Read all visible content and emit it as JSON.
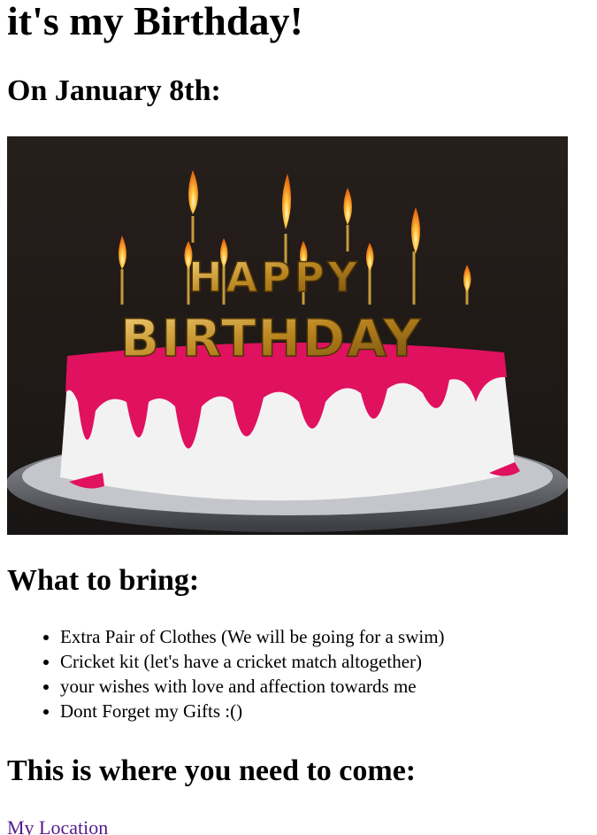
{
  "heading": "it's my Birthday!",
  "date_heading": "On January 8th:",
  "image": {
    "candle_letters_top": "HAPPY",
    "candle_letters_bottom": "BIRTHDAY"
  },
  "bring_heading": "What to bring:",
  "bring_items": [
    "Extra Pair of Clothes (We will be going for a swim)",
    "Cricket kit (let's have a cricket match altogether)",
    "your wishes with love and affection towards me",
    "Dont Forget my Gifts :()"
  ],
  "where_heading": "This is where you need to come:",
  "location_link": "My Location",
  "colors": {
    "link_visited": "#551a8b",
    "icing": "#e0115f",
    "frosting": "#f4f4f4"
  }
}
